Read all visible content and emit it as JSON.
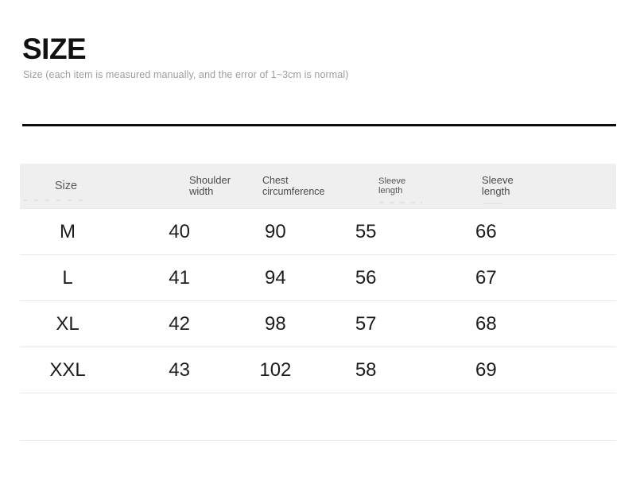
{
  "heading": {
    "title": "SIZE",
    "subtitle": "Size (each item is measured manually, and the error of 1~3cm is normal)"
  },
  "colors": {
    "rule": "#0c0c0c",
    "header_background": "#efefef",
    "row_divider": "#e9e9e9",
    "title_text": "#111111",
    "subtitle_text": "#9d9d9d",
    "header_text": "#4a4a4a",
    "value_text": "#1d1d1d"
  },
  "table": {
    "columns": [
      {
        "key": "size",
        "label_line1": "Size",
        "label_line2": ""
      },
      {
        "key": "shoulder",
        "label_line1": "Shoulder",
        "label_line2": "width"
      },
      {
        "key": "chest",
        "label_line1": "Chest",
        "label_line2": "circumference"
      },
      {
        "key": "sleeve_a",
        "label_line1": "Sleeve",
        "label_line2": "length"
      },
      {
        "key": "sleeve_b",
        "label_line1": "Sleeve",
        "label_line2": "length"
      }
    ],
    "rows": [
      {
        "size": "M",
        "shoulder": "40",
        "chest": "90",
        "sleeve_a": "55",
        "sleeve_b": "66"
      },
      {
        "size": "L",
        "shoulder": "41",
        "chest": "94",
        "sleeve_a": "56",
        "sleeve_b": "67"
      },
      {
        "size": "XL",
        "shoulder": "42",
        "chest": "98",
        "sleeve_a": "57",
        "sleeve_b": "68"
      },
      {
        "size": "XXL",
        "shoulder": "43",
        "chest": "102",
        "sleeve_a": "58",
        "sleeve_b": "69"
      }
    ],
    "empty_rows": 2
  }
}
